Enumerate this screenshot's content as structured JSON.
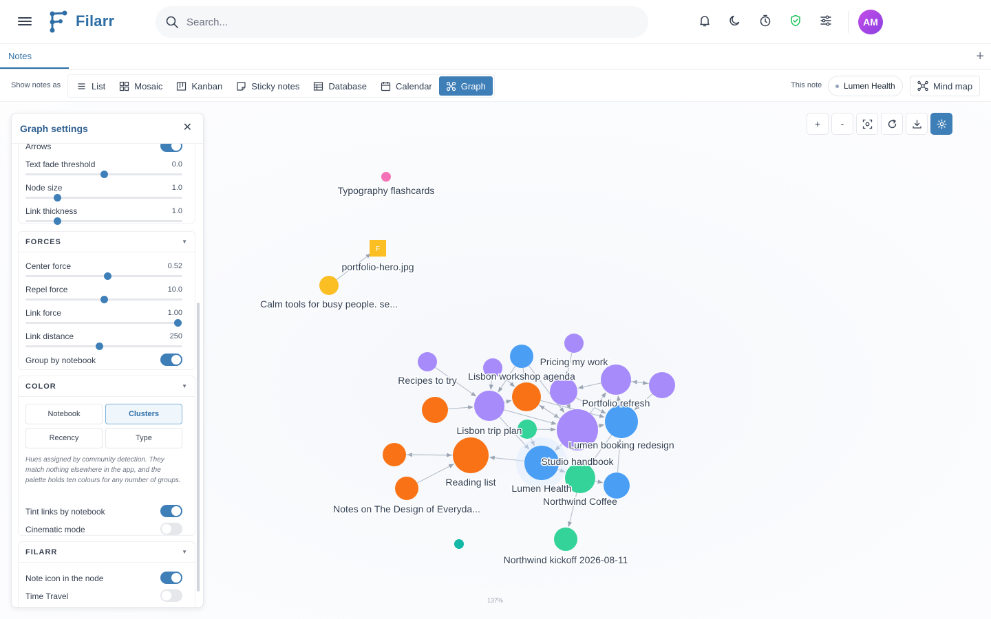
{
  "app": {
    "name": "Filarr",
    "avatar_initials": "AM"
  },
  "search": {
    "placeholder": "Search..."
  },
  "tabs": [
    {
      "label": "Notes"
    }
  ],
  "viewbar": {
    "show_label": "Show notes as",
    "views": [
      {
        "label": "List",
        "icon": "list-icon"
      },
      {
        "label": "Mosaic",
        "icon": "mosaic-icon"
      },
      {
        "label": "Kanban",
        "icon": "kanban-icon"
      },
      {
        "label": "Sticky notes",
        "icon": "sticky-note-icon"
      },
      {
        "label": "Database",
        "icon": "database-icon"
      },
      {
        "label": "Calendar",
        "icon": "calendar-icon"
      },
      {
        "label": "Graph",
        "icon": "graph-icon",
        "active": true
      }
    ],
    "this_note_label": "This note",
    "current_note": "Lumen Health",
    "mindmap_label": "Mind map"
  },
  "graph_tools": {
    "zoom_in": "+",
    "zoom_out": "-"
  },
  "zoom_level": "137%",
  "settings": {
    "title": "Graph settings",
    "partial_label": "Arrows",
    "display": {
      "text_fade_threshold": {
        "label": "Text fade threshold",
        "value": "0.0",
        "pos": 0.5
      },
      "node_size": {
        "label": "Node size",
        "value": "1.0",
        "pos": 0.2
      },
      "link_thickness": {
        "label": "Link thickness",
        "value": "1.0",
        "pos": 0.2
      }
    },
    "forces": {
      "title": "FORCES",
      "center_force": {
        "label": "Center force",
        "value": "0.52",
        "pos": 0.52
      },
      "repel_force": {
        "label": "Repel force",
        "value": "10.0",
        "pos": 0.5
      },
      "link_force": {
        "label": "Link force",
        "value": "1.00",
        "pos": 0.97
      },
      "link_distance": {
        "label": "Link distance",
        "value": "250",
        "pos": 0.47
      },
      "group_by_notebook": {
        "label": "Group by notebook",
        "on": true
      }
    },
    "color": {
      "title": "COLOR",
      "options": [
        "Notebook",
        "Clusters",
        "Recency",
        "Type"
      ],
      "selected": "Clusters",
      "hint": "Hues assigned by community detection. They match nothing elsewhere in the app, and the palette holds ten colours for any number of groups.",
      "tint_links": {
        "label": "Tint links by notebook",
        "on": true
      },
      "cinematic": {
        "label": "Cinematic mode",
        "on": false
      }
    },
    "filarr": {
      "title": "FILARR",
      "note_icon": {
        "label": "Note icon in the node",
        "on": true
      },
      "time_travel": {
        "label": "Time Travel",
        "on": false
      }
    }
  },
  "graph": {
    "colors": {
      "purple": "#a78bfa",
      "orange": "#f97316",
      "blue": "#4a9ff5",
      "green": "#34d399",
      "pink": "#f472b6",
      "yellow": "#fbbf24",
      "teal": "#14b8a6"
    },
    "nodes": [
      {
        "id": "typography",
        "label": "Typography flashcards"
      },
      {
        "id": "portfolio_hero",
        "label": "portfolio-hero.jpg",
        "badge": "F"
      },
      {
        "id": "calm",
        "label": "Calm tools for busy people. se..."
      },
      {
        "id": "pricing",
        "label": "Pricing my work"
      },
      {
        "id": "lisbon_workshop",
        "label": "Lisbon workshop agenda"
      },
      {
        "id": "recipes",
        "label": "Recipes to try"
      },
      {
        "id": "portfolio_refresh",
        "label": "Portfolio refresh"
      },
      {
        "id": "lisbon_trip",
        "label": "Lisbon trip plan"
      },
      {
        "id": "lumen_booking",
        "label": "Lumen booking redesign"
      },
      {
        "id": "studio",
        "label": "Studio handbook"
      },
      {
        "id": "reading",
        "label": "Reading list"
      },
      {
        "id": "lumen_health",
        "label": "Lumen Health"
      },
      {
        "id": "northwind_coffee",
        "label": "Northwind Coffee"
      },
      {
        "id": "design_everyday",
        "label": "Notes on The Design of Everyda..."
      },
      {
        "id": "northwind_kickoff",
        "label": "Northwind kickoff 2026-08-11"
      }
    ]
  }
}
